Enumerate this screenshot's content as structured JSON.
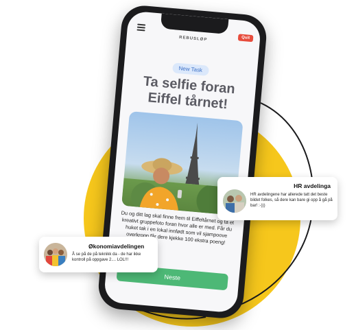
{
  "app": {
    "brand": "REBUSLØP",
    "quit_label": "Quit"
  },
  "task": {
    "badge": "New Task",
    "title_line1": "Ta selfie foran",
    "title_line2": "Eiffel tårnet!",
    "description": "Du og ditt lag skal finne frem til Eiffeltårnet og ta et kreativt gruppefoto foran hvor alle er med. Får du huket tak i en lokal innfødt som vil sjampoove overkropp får dere kjekke 100 ekstra poeng!",
    "next_label": "Neste"
  },
  "chats": {
    "hr": {
      "name": "HR avdelinga",
      "message": "HR avdelingene har allerede tatt det beste bildet folkes, så dere kan bare gi opp å gå på bar! :-)))"
    },
    "okonomi": {
      "name": "Økonomiavdelingen",
      "message": "Å se på de på teknikk da - de har ikke kontroll på oppgave 2.... LOL!!!"
    }
  },
  "colors": {
    "accent_yellow": "#f6c71c",
    "next_green": "#4db876",
    "quit_red": "#e74c3c",
    "badge_blue": "#dbe8fb"
  },
  "icons": [
    "menu-icon",
    "avatar-hr",
    "avatar-okonomi"
  ]
}
